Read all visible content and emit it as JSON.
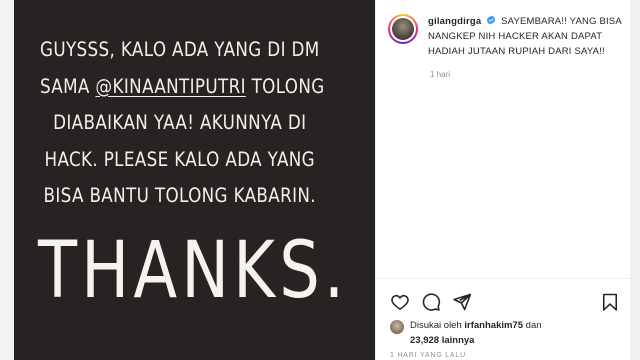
{
  "post_image": {
    "lines": [
      "GUYSSS, KALO ADA YANG DI DM",
      "TOLONG",
      "DIABAIKAN YAA! AKUNNYA DI",
      "HACK. PLEASE KALO ADA YANG",
      "BISA BANTU TOLONG KABARIN."
    ],
    "line2_prefix": "SAMA ",
    "mention": "@KINAANTIPUTRI",
    "thanks": "THANKS."
  },
  "post_header": {
    "username": "gilangdirga",
    "caption": "SAYEMBARA!! YANG BISA NANGKEP NIH HACKER AKAN DAPAT HADIAH JUTAAN RUPIAH DARI SAYA!!",
    "time_ago": "1 hari"
  },
  "likes": {
    "prefix": "Disukai oleh",
    "user": "irfanhakim75",
    "joiner": "dan",
    "count": "23,928",
    "suffix": "lainnya"
  },
  "date_text": "1 HARI YANG LALU",
  "colors": {
    "image_bg": "#262322",
    "image_text": "#f1efea",
    "verified_blue": "#3897f0",
    "meta_gray": "#8e8e8e"
  },
  "icons": [
    "heart-icon",
    "comment-icon",
    "share-icon",
    "bookmark-icon",
    "verified-badge-icon"
  ]
}
